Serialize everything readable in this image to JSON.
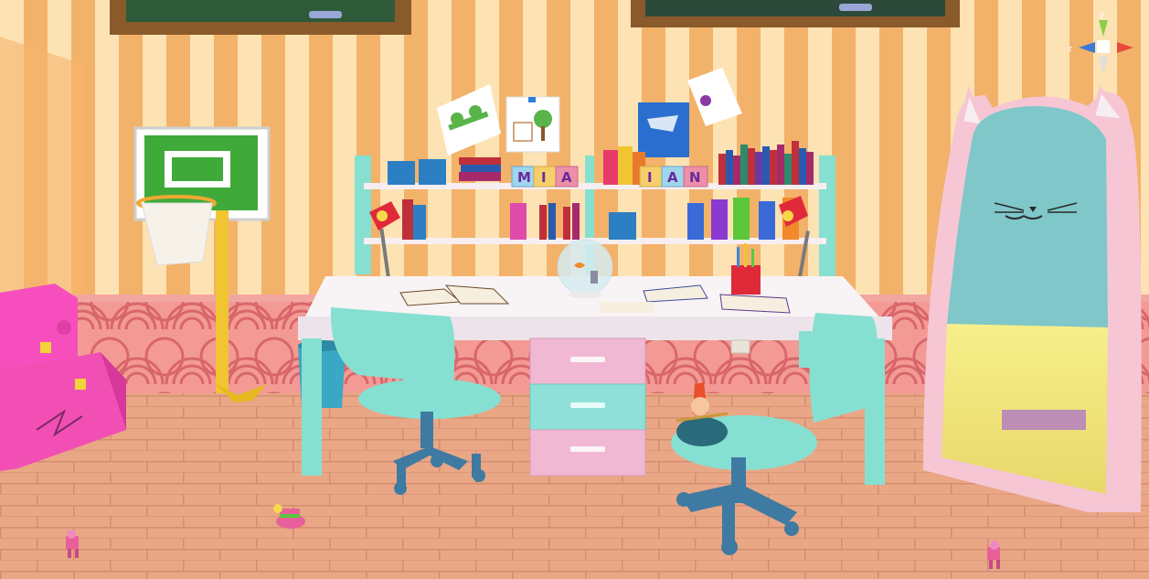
{
  "scene": {
    "blocks_left": [
      "M",
      "I",
      "A"
    ],
    "blocks_right": [
      "I",
      "A",
      "N"
    ]
  },
  "gizmo": {
    "y_label": "y",
    "z_label": "z"
  },
  "colors": {
    "wall_stripe_light": "#fde2b4",
    "wall_stripe_dark": "#f3b26a",
    "wainscot": "#f08f8c",
    "floor": "#e9a786",
    "desk_top": "#f8f3f5",
    "chair": "#86e0d2",
    "chair_base": "#3f7aa3",
    "drawer_pink": "#f1b8d3",
    "drawer_teal": "#8fe1d8",
    "mirror_frame": "#f6c6d4",
    "toy_box": "#f24fb4"
  }
}
